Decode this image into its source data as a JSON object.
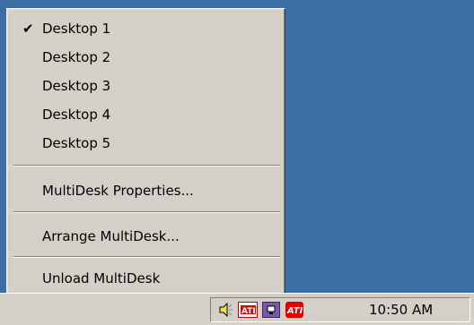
{
  "menu": {
    "items": [
      {
        "label": "Desktop 1",
        "checked": true
      },
      {
        "label": "Desktop 2",
        "checked": false
      },
      {
        "label": "Desktop 3",
        "checked": false
      },
      {
        "label": "Desktop 4",
        "checked": false
      },
      {
        "label": "Desktop 5",
        "checked": false
      },
      {
        "label": "MultiDesk Properties...",
        "checked": false
      },
      {
        "label": "Arrange MultiDesk...",
        "checked": false
      },
      {
        "label": "Unload MultiDesk",
        "checked": false
      }
    ],
    "check_glyph": "✔"
  },
  "tray": {
    "icons": [
      "speaker-icon",
      "ati-display-icon",
      "monitor-icon",
      "ati-logo-icon"
    ],
    "clock": "10:50 AM"
  },
  "colors": {
    "desktop": "#3a6ea5",
    "menu_bg": "#d4d0c8",
    "ati_red": "#e00000",
    "monitor_purple": "#7a5aa8"
  }
}
